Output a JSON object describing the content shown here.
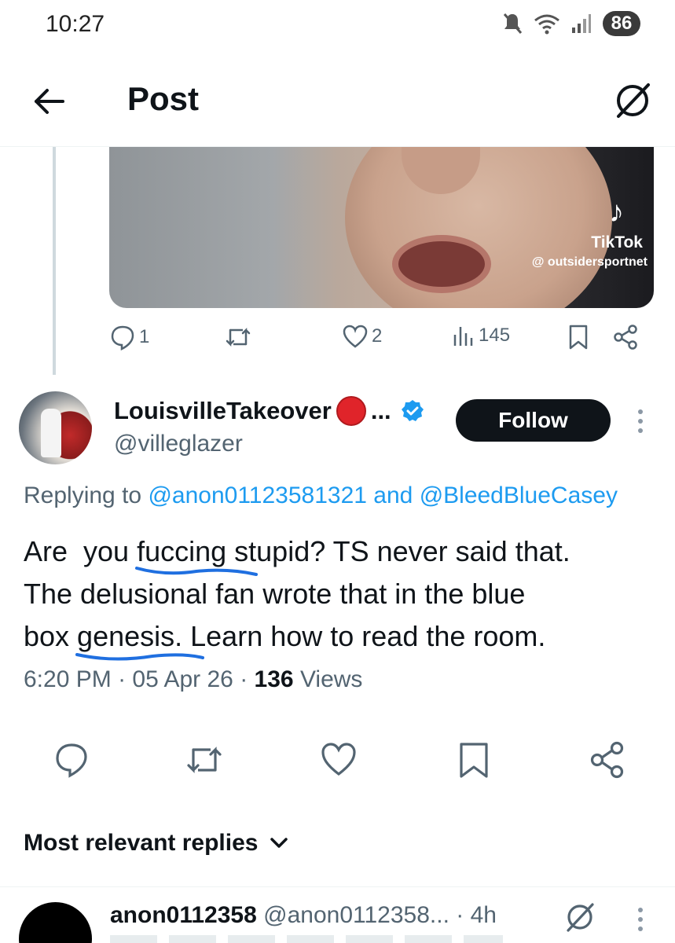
{
  "status_bar": {
    "time": "10:27",
    "battery": "86",
    "icons": [
      "mute-icon",
      "wifi-icon",
      "signal-icon",
      "battery-icon"
    ]
  },
  "header": {
    "title": "Post",
    "back_icon": "arrow-left-icon",
    "grok_icon": "grok-icon"
  },
  "previous_post": {
    "media": {
      "watermark_brand": "TikTok",
      "watermark_handle": "@ outsidersportnet"
    },
    "actions": {
      "replies": "1",
      "likes": "2",
      "views": "145"
    }
  },
  "post": {
    "display_name": "LouisvilleTakeover",
    "name_suffix": "...",
    "username": "@villeglazer",
    "follow_label": "Follow",
    "replying_prefix": "Replying to",
    "reply_to_1": "@anon01123581321",
    "reply_and": "and",
    "reply_to_2": "@BleedBlueCasey",
    "text_lines": {
      "l1a": "Are  you ",
      "l1b": "fuccing",
      "l1c": " stupid? TS never said that.",
      "l2": "The delusional fan wrote that in the blue",
      "l3a": "box ",
      "l3b": "genesis.",
      "l3c": " Learn how to read the room."
    },
    "time": "6:20 PM",
    "date": "05 Apr 26",
    "views_count": "136",
    "views_label": "Views",
    "colors": {
      "link": "#1d9bf0",
      "scribble": "#1f6fe0",
      "verified": "#1d9bf0",
      "follow_bg": "#0f1419"
    }
  },
  "replies": {
    "sort_label": "Most relevant replies",
    "first_reply": {
      "display_name": "anon0112358",
      "username": "@anon0112358...",
      "time": "4h"
    }
  }
}
